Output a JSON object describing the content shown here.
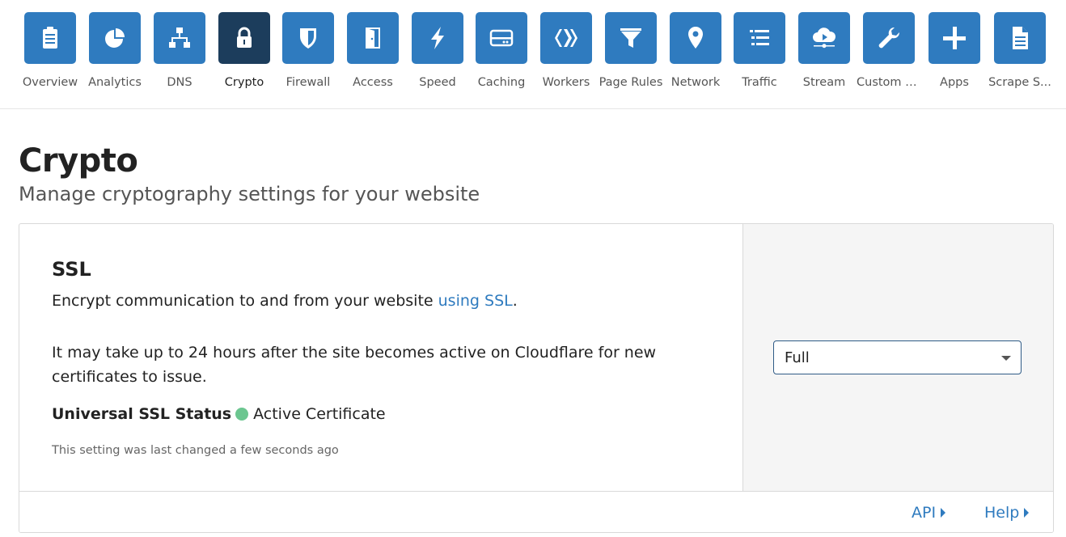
{
  "nav": {
    "items": [
      {
        "label": "Overview",
        "icon": "clipboard-icon",
        "active": false
      },
      {
        "label": "Analytics",
        "icon": "pie-chart-icon",
        "active": false
      },
      {
        "label": "DNS",
        "icon": "network-tree-icon",
        "active": false
      },
      {
        "label": "Crypto",
        "icon": "lock-icon",
        "active": true
      },
      {
        "label": "Firewall",
        "icon": "shield-icon",
        "active": false
      },
      {
        "label": "Access",
        "icon": "door-icon",
        "active": false
      },
      {
        "label": "Speed",
        "icon": "lightning-icon",
        "active": false
      },
      {
        "label": "Caching",
        "icon": "server-drive-icon",
        "active": false
      },
      {
        "label": "Workers",
        "icon": "workers-chevrons-icon",
        "active": false
      },
      {
        "label": "Page Rules",
        "icon": "funnel-icon",
        "active": false
      },
      {
        "label": "Network",
        "icon": "location-pin-icon",
        "active": false
      },
      {
        "label": "Traffic",
        "icon": "list-icon",
        "active": false
      },
      {
        "label": "Stream",
        "icon": "cloud-play-icon",
        "active": false
      },
      {
        "label": "Custom P...",
        "icon": "wrench-icon",
        "active": false
      },
      {
        "label": "Apps",
        "icon": "plus-icon",
        "active": false
      },
      {
        "label": "Scrape S...",
        "icon": "document-icon",
        "active": false
      }
    ]
  },
  "page": {
    "title": "Crypto",
    "subtitle": "Manage cryptography settings for your website"
  },
  "ssl_card": {
    "title": "SSL",
    "desc_prefix": "Encrypt communication to and from your website ",
    "desc_link": "using SSL",
    "desc_suffix": ".",
    "note": "It may take up to 24 hours after the site becomes active on Cloudflare for new certificates to issue.",
    "status_label": "Universal SSL Status",
    "status_value": "Active Certificate",
    "status_color": "#6cc690",
    "changed_note": "This setting was last changed a few seconds ago",
    "mode_selected": "Full",
    "footer_api": "API",
    "footer_help": "Help"
  },
  "colors": {
    "accent": "#2f7bbf",
    "active_tile": "#1c3d5c"
  }
}
